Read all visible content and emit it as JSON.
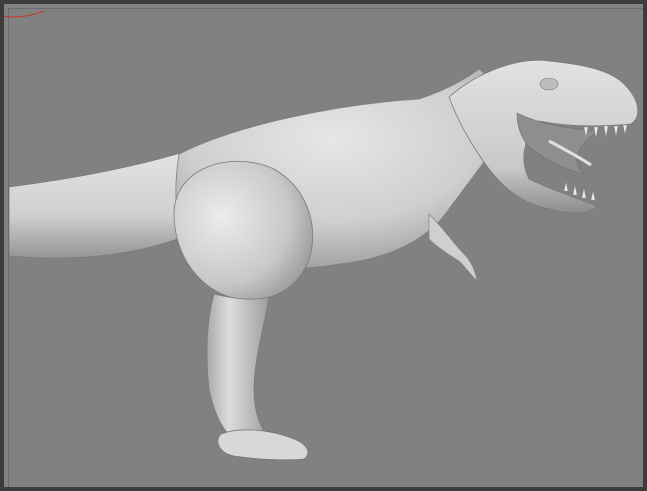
{
  "viewport": {
    "background_color": "#818181",
    "frame_color": "#3c3c3c"
  },
  "scene": {
    "model": {
      "icon": "dinosaur-model-icon",
      "base_color": "#d4d4d4",
      "shadow_color": "#8e8e8e"
    },
    "corner_marker": {
      "icon": "corner-selection-arc-icon",
      "color": "#c0392b"
    }
  }
}
